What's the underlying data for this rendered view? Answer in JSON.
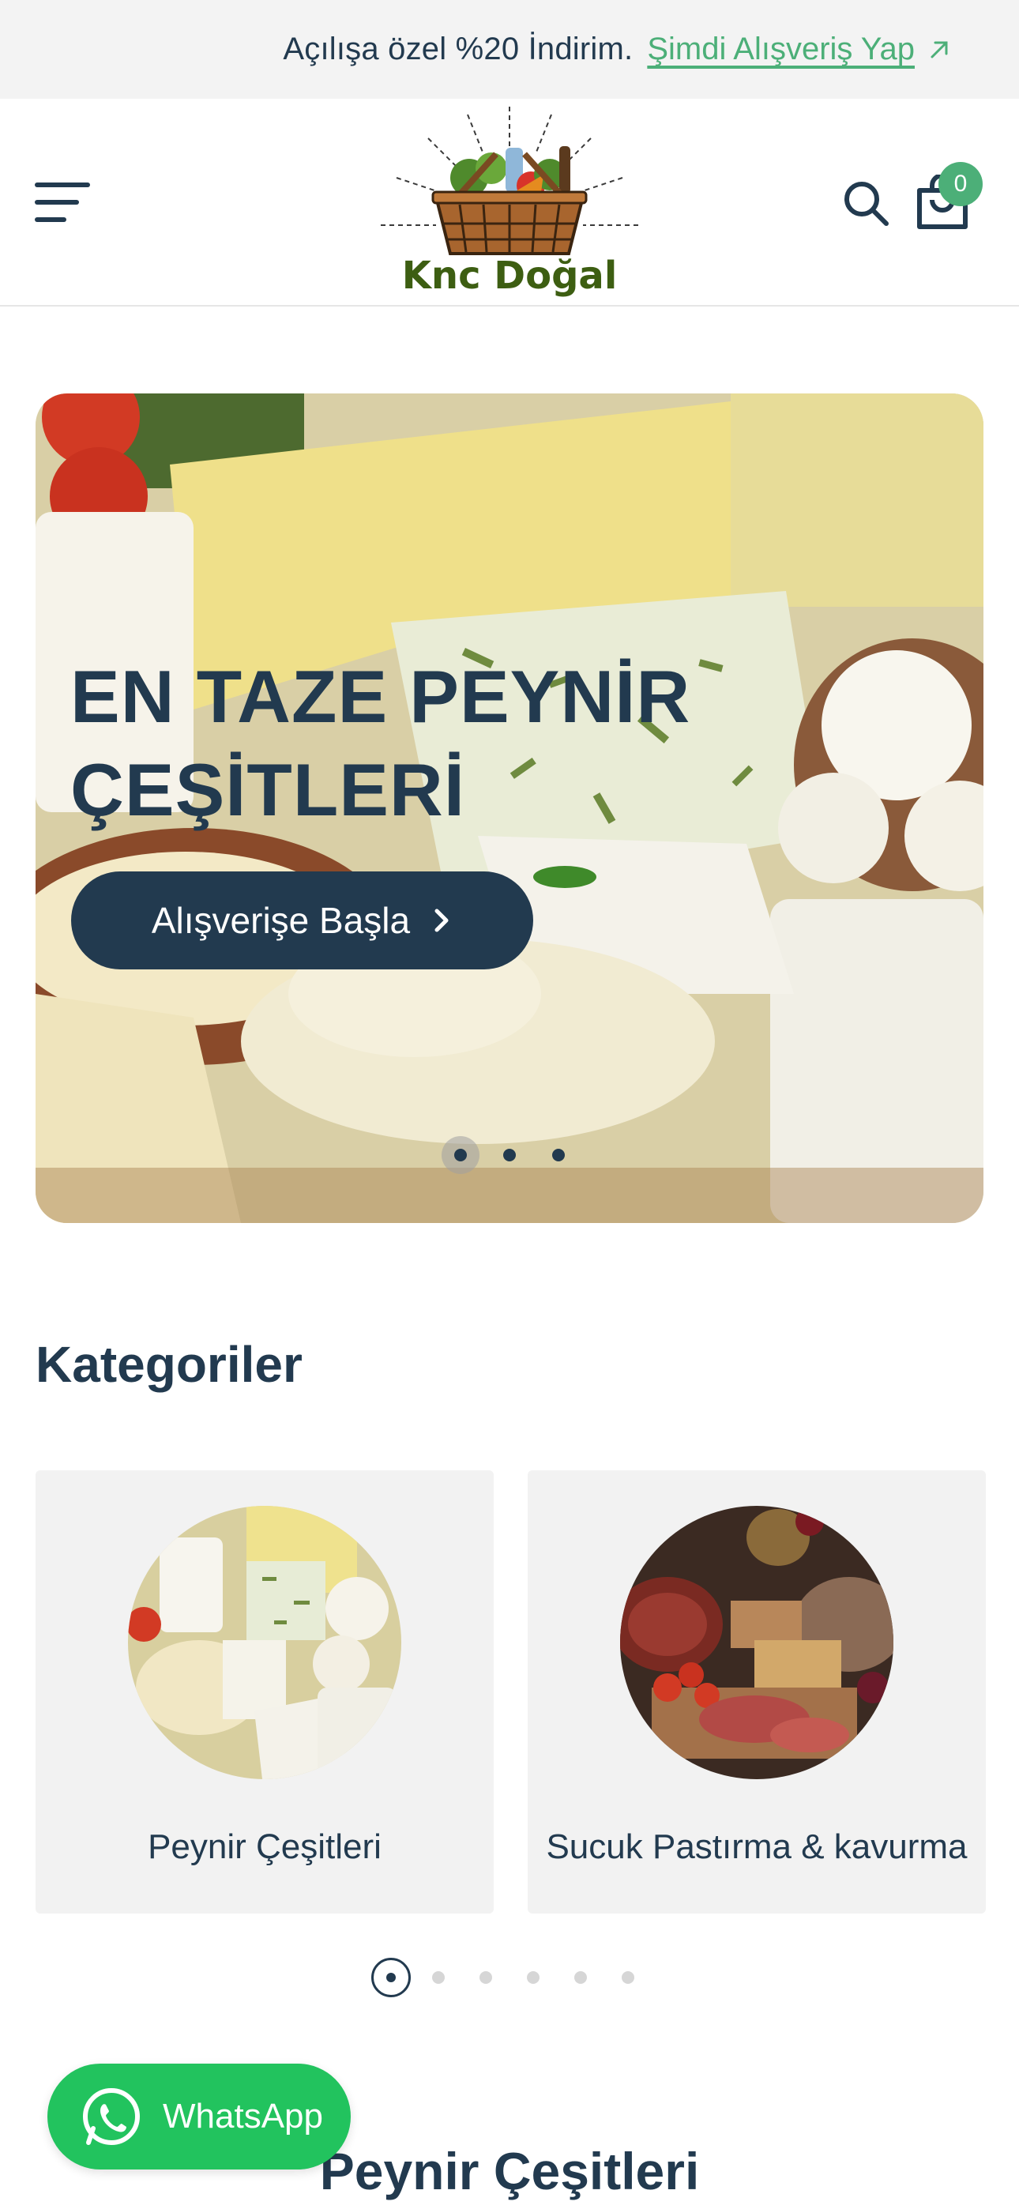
{
  "announcement": {
    "text": "Açılışa özel %20 İndirim.",
    "link_label": "Şimdi Alışveriş Yap"
  },
  "header": {
    "logo_text": "Knc Doğal",
    "cart_count": "0",
    "menu_icon": "hamburger-menu-icon",
    "search_icon": "search-icon",
    "cart_icon": "shopping-bag-icon"
  },
  "hero": {
    "title": "EN TAZE PEYNİR ÇEŞİTLERİ",
    "cta_label": "Alışverişe Başla",
    "slides_count": 3,
    "active_slide": 1
  },
  "categories": {
    "title": "Kategoriler",
    "items": [
      {
        "label": "Peynir Çeşitleri"
      },
      {
        "label": "Sucuk Pastırma & kavurma"
      }
    ],
    "pages": 6,
    "active_page": 1
  },
  "next_section": {
    "title": "Peynir Çeşitleri"
  },
  "whatsapp": {
    "label": "WhatsApp"
  },
  "colors": {
    "primary": "#223a4f",
    "accent": "#4caf78",
    "whatsapp": "#22c35e",
    "announcement_bg": "#f3f3f3",
    "card_bg": "#f2f2f2"
  }
}
